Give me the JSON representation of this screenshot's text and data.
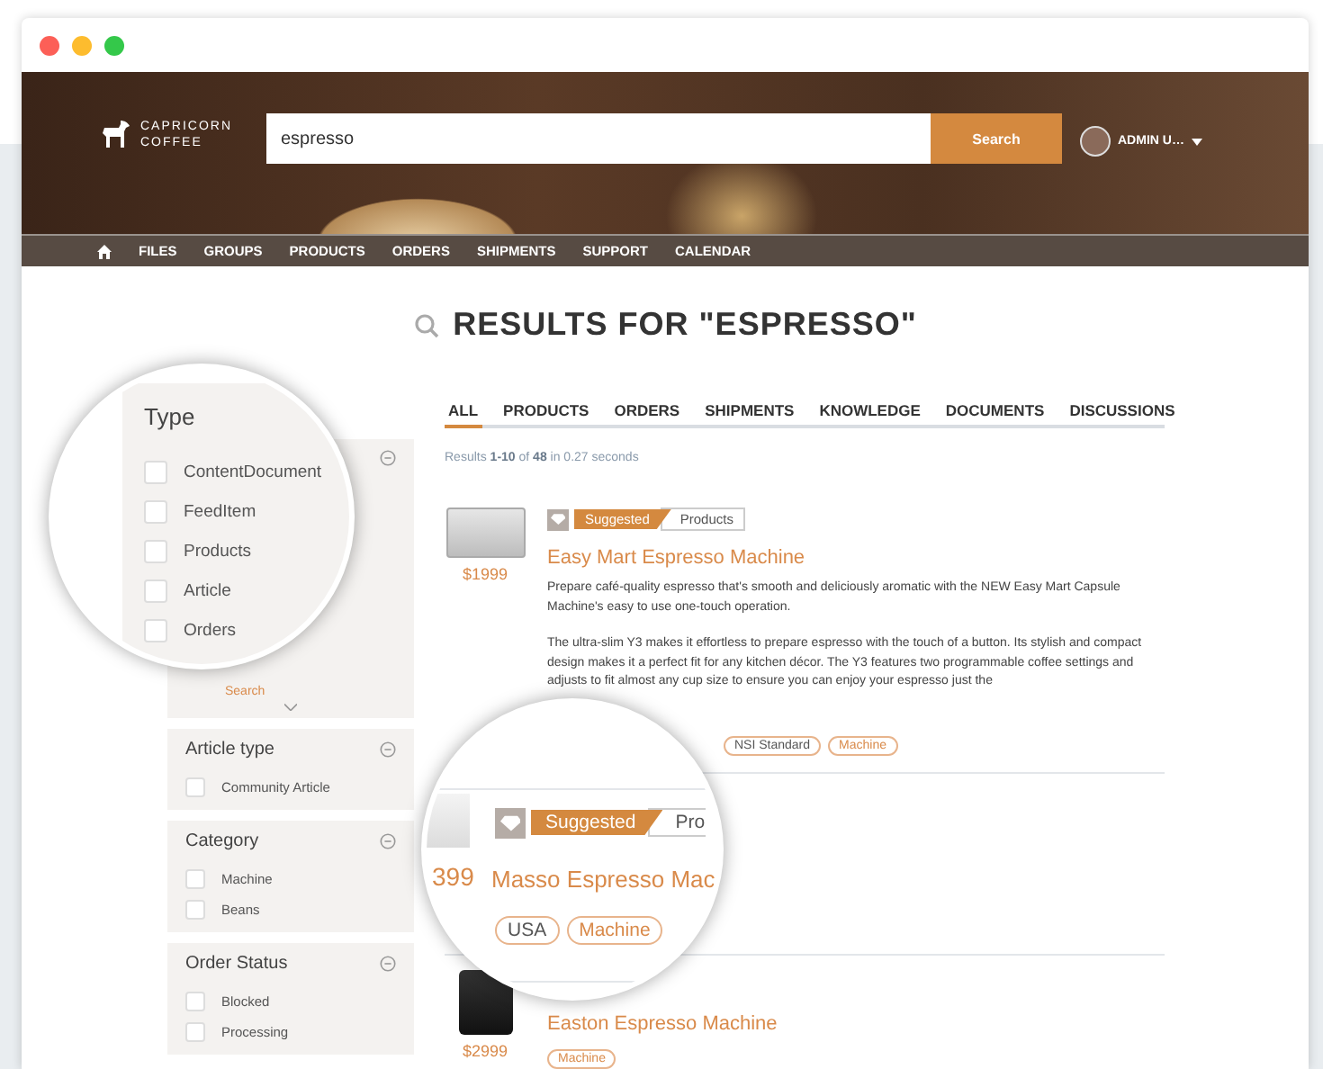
{
  "window": {
    "controls": [
      {
        "color": "#fc5f57"
      },
      {
        "color": "#fdbc2e"
      },
      {
        "color": "#34c84a"
      }
    ]
  },
  "header": {
    "logo": {
      "line1": "CAPRICORN",
      "line2": "COFFEE"
    },
    "search": {
      "value": "espresso",
      "button": "Search"
    },
    "user": {
      "name": "ADMIN U…"
    }
  },
  "nav": [
    "FILES",
    "GROUPS",
    "PRODUCTS",
    "ORDERS",
    "SHIPMENTS",
    "SUPPORT",
    "CALENDAR"
  ],
  "heading": "RESULTS FOR \"ESPRESSO\"",
  "filters": [
    {
      "title": "Type",
      "magnified": true,
      "link": "Search",
      "options": [
        {
          "label": "ContentDocument",
          "checked": false
        },
        {
          "label": "FeedItem",
          "checked": false
        },
        {
          "label": "Products",
          "checked": false
        },
        {
          "label": "Article",
          "checked": false
        },
        {
          "label": "Orders",
          "checked": false
        }
      ]
    },
    {
      "title": "Article type",
      "magnified": false,
      "options": [
        {
          "label": "Community Article",
          "checked": false
        }
      ]
    },
    {
      "title": "Category",
      "magnified": false,
      "options": [
        {
          "label": "Machine",
          "checked": false
        },
        {
          "label": "Beans",
          "checked": false
        }
      ]
    },
    {
      "title": "Order Status",
      "magnified": false,
      "options": [
        {
          "label": "Blocked",
          "checked": false
        },
        {
          "label": "Processing",
          "checked": false
        }
      ]
    }
  ],
  "tabs": [
    {
      "label": "ALL",
      "selected": true
    },
    {
      "label": "PRODUCTS",
      "selected": false
    },
    {
      "label": "ORDERS",
      "selected": false
    },
    {
      "label": "SHIPMENTS",
      "selected": false
    },
    {
      "label": "KNOWLEDGE",
      "selected": false
    },
    {
      "label": "DOCUMENTS",
      "selected": false
    },
    {
      "label": "DISCUSSIONS",
      "selected": false
    }
  ],
  "summary": "Results **1-10** of **48** in 0.27 seconds",
  "results": [
    {
      "kind": "full",
      "price": "$1999",
      "badge": "Suggested",
      "type": "Products",
      "title": "Easy Mart Espresso Machine",
      "paragraphs": [
        "Prepare café-quality espresso that's smooth and deliciously aromatic with the NEW Easy Mart Capsule Machine's easy to use one-touch operation.",
        "The ultra-slim Y3 makes it effortless to prepare espresso with the touch of a button. Its stylish and compact design makes it a perfect fit for any kitchen décor. The Y3 features two programmable coffee settings and adjusts to fit almost any cup size to ensure you can enjoy your espresso just the"
      ],
      "tags": [
        {
          "label": "NSI Standard",
          "color": "#555555"
        },
        {
          "label": "Machine",
          "color": "#d98a4a"
        }
      ]
    },
    {
      "kind": "magnified",
      "price": "399",
      "badge": "Suggested",
      "type": "Pro",
      "title": "Masso Espresso Mac",
      "tags": [
        {
          "label": "USA",
          "color": "#555555"
        },
        {
          "label": "Machine",
          "color": "#d98a4a"
        }
      ]
    },
    {
      "kind": "partial",
      "price": "$2999",
      "title": "Easton Espresso Machine",
      "tags": [
        {
          "label": "Machine",
          "color": "#d98a4a"
        }
      ]
    }
  ]
}
